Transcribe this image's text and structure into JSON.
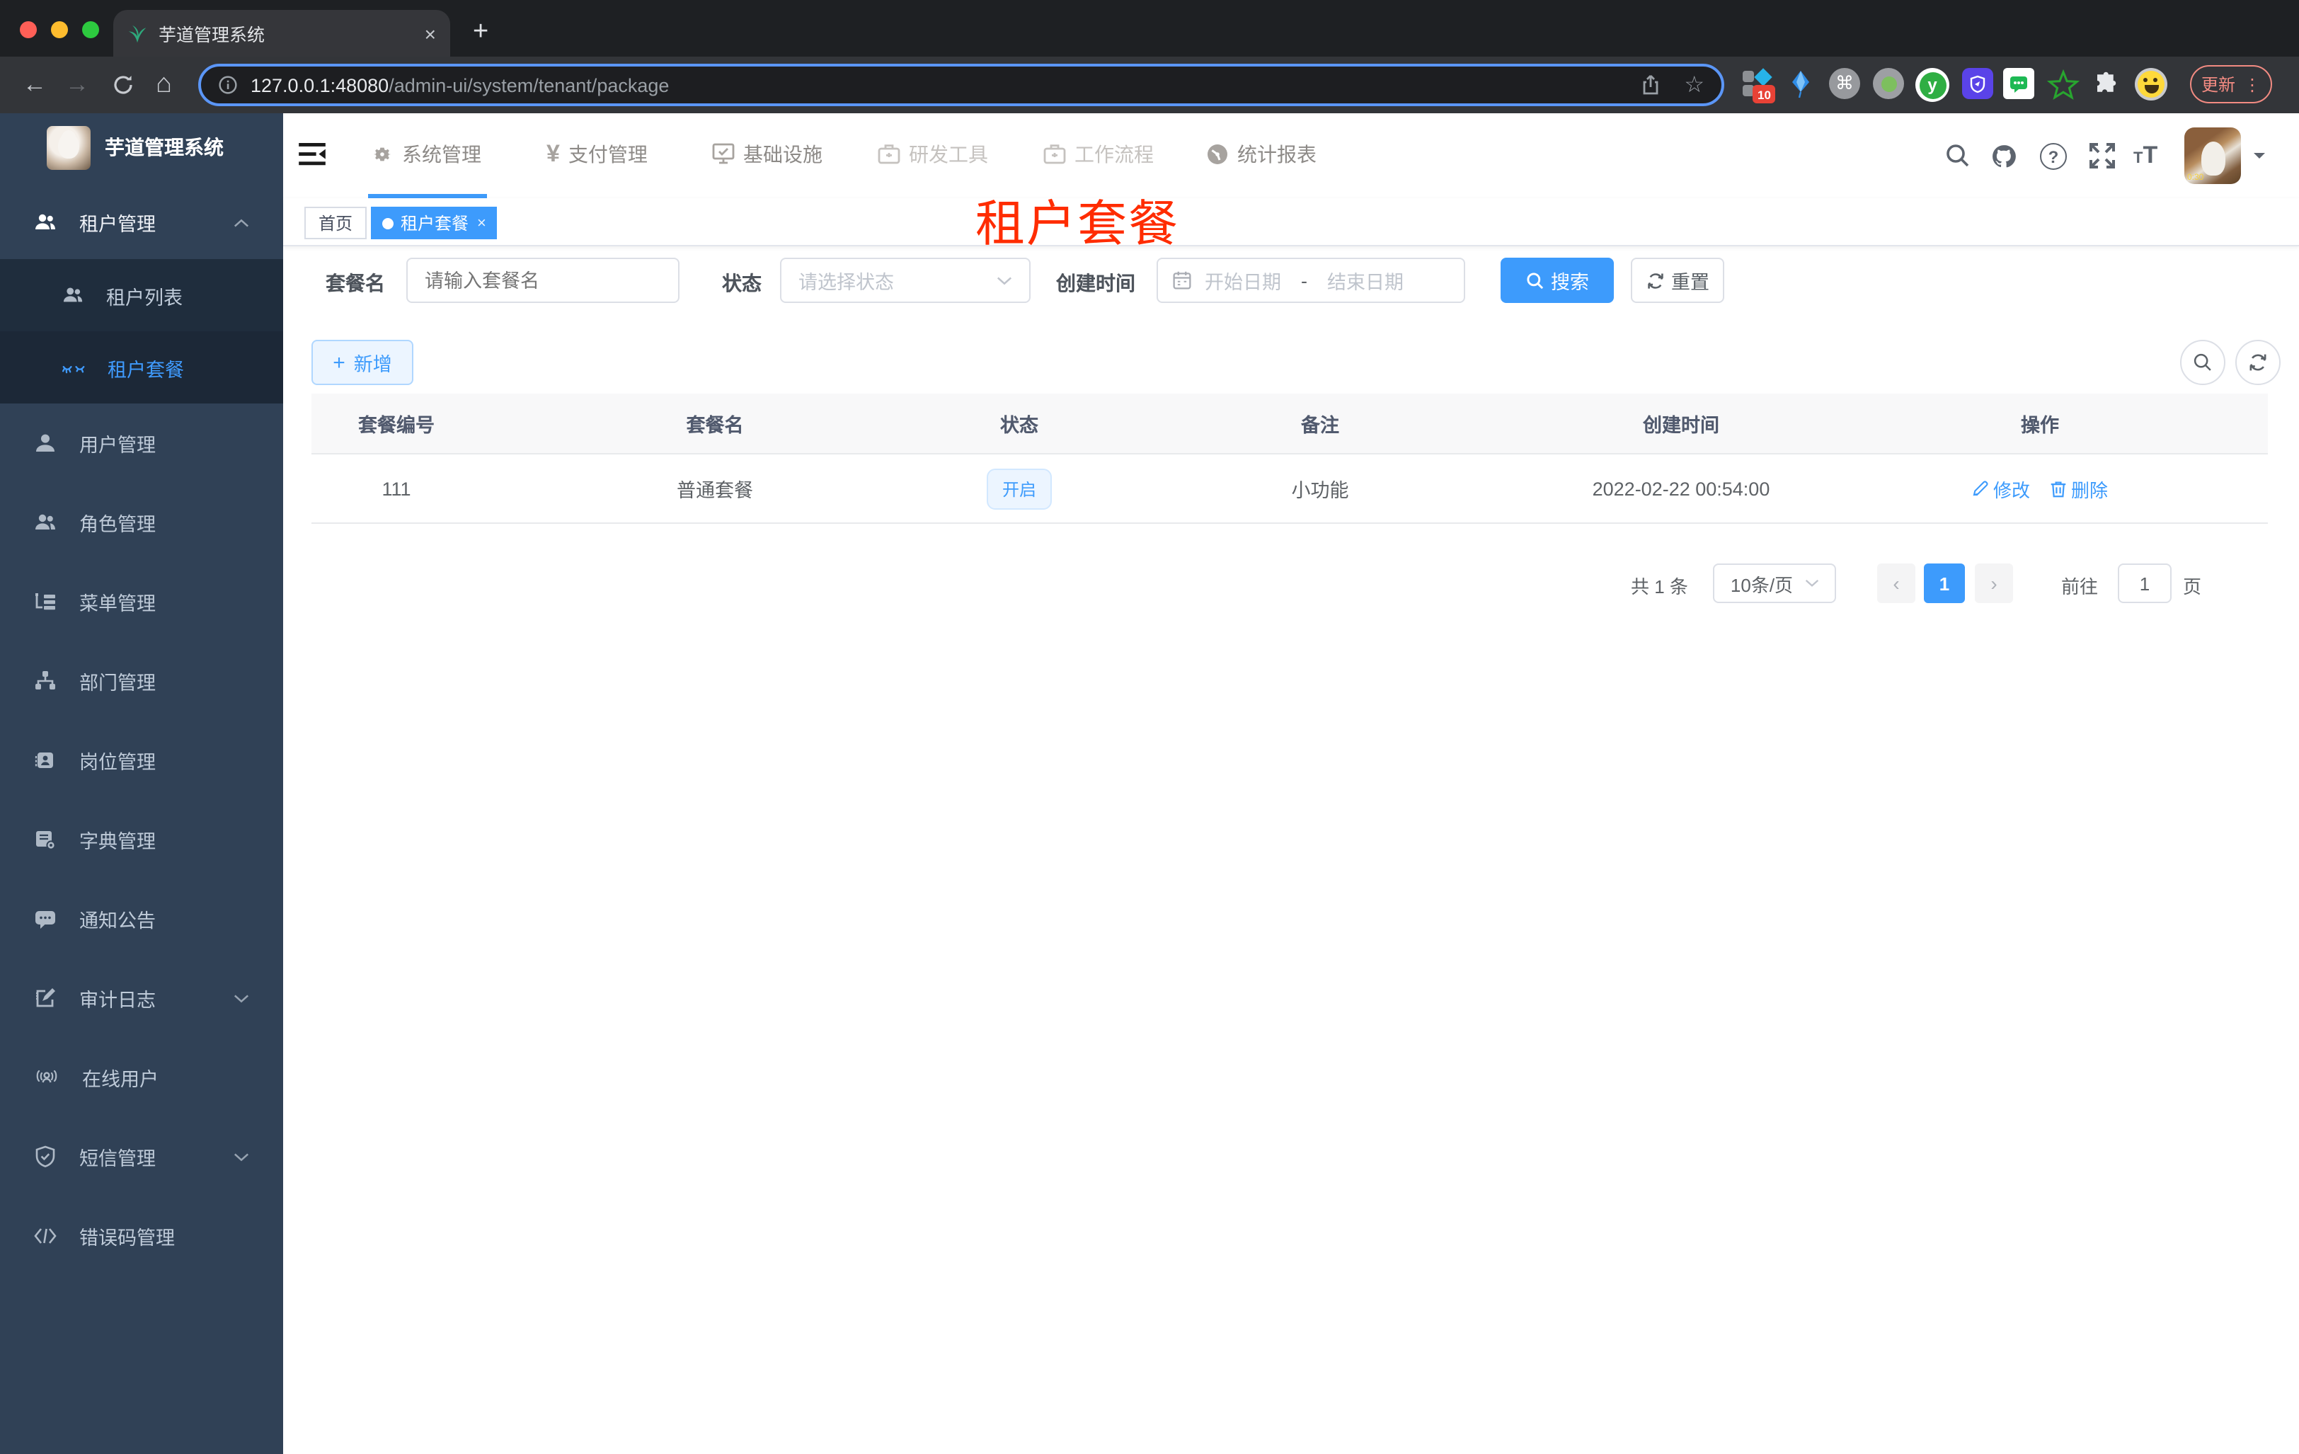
{
  "glyphs": {
    "close": "×",
    "add_tab": "+",
    "back": "←",
    "forward": "→",
    "home": "⌂",
    "star": "☆",
    "command": "⌘",
    "kebab": "⋮",
    "yen": "¥",
    "question": "?",
    "prev": "‹",
    "next": "›",
    "dot_sep": "-",
    "plus": "+",
    "font_small": "T",
    "font_big": "T"
  },
  "colors": {
    "accent": "#3d9bfc",
    "watermark_red": "#ff2c00",
    "sidebar_bg": "#304156",
    "submenu_bg": "#1f2d3d",
    "tag_active_bg": "#3d9bfc",
    "status_tag_bg": "#ecf5ff"
  },
  "browser": {
    "tab_title": "芋道管理系统",
    "url_host": "127.0.0.1:48080",
    "url_path": "/admin-ui/system/tenant/package",
    "extension_badge": "10",
    "update_label": "更新"
  },
  "app": {
    "sidebar": {
      "title": "芋道管理系统",
      "items": [
        {
          "label": "租户管理"
        },
        {
          "label": "租户列表"
        },
        {
          "label": "租户套餐"
        },
        {
          "label": "用户管理"
        },
        {
          "label": "角色管理"
        },
        {
          "label": "菜单管理"
        },
        {
          "label": "部门管理"
        },
        {
          "label": "岗位管理"
        },
        {
          "label": "字典管理"
        },
        {
          "label": "通知公告"
        },
        {
          "label": "审计日志"
        },
        {
          "label": "在线用户"
        },
        {
          "label": "短信管理"
        },
        {
          "label": "错误码管理"
        }
      ]
    },
    "nav": [
      {
        "label": "系统管理",
        "active": true
      },
      {
        "label": "支付管理"
      },
      {
        "label": "基础设施"
      },
      {
        "label": "研发工具"
      },
      {
        "label": "工作流程"
      },
      {
        "label": "统计报表"
      }
    ],
    "tags": {
      "home": "首页",
      "active": "租户套餐"
    },
    "watermark": "租户套餐"
  },
  "filters": {
    "name_label": "套餐名",
    "name_placeholder": "请输入套餐名",
    "status_label": "状态",
    "status_placeholder": "请选择状态",
    "date_label": "创建时间",
    "date_start": "开始日期",
    "date_separator": "-",
    "date_end": "结束日期",
    "search_label": "搜索",
    "reset_label": "重置"
  },
  "toolbar": {
    "add_label": "新增"
  },
  "table": {
    "headers": [
      "套餐编号",
      "套餐名",
      "状态",
      "备注",
      "创建时间",
      "操作"
    ],
    "rows": [
      {
        "id": "111",
        "name": "普通套餐",
        "status": "开启",
        "remark": "小功能",
        "created": "2022-02-22 00:54:00",
        "edit": "修改",
        "delete": "删除"
      }
    ]
  },
  "pagination": {
    "total": "共 1 条",
    "per_page": "10条/页",
    "page": "1",
    "goto_label": "前往",
    "goto_value": "1",
    "unit": "页"
  }
}
